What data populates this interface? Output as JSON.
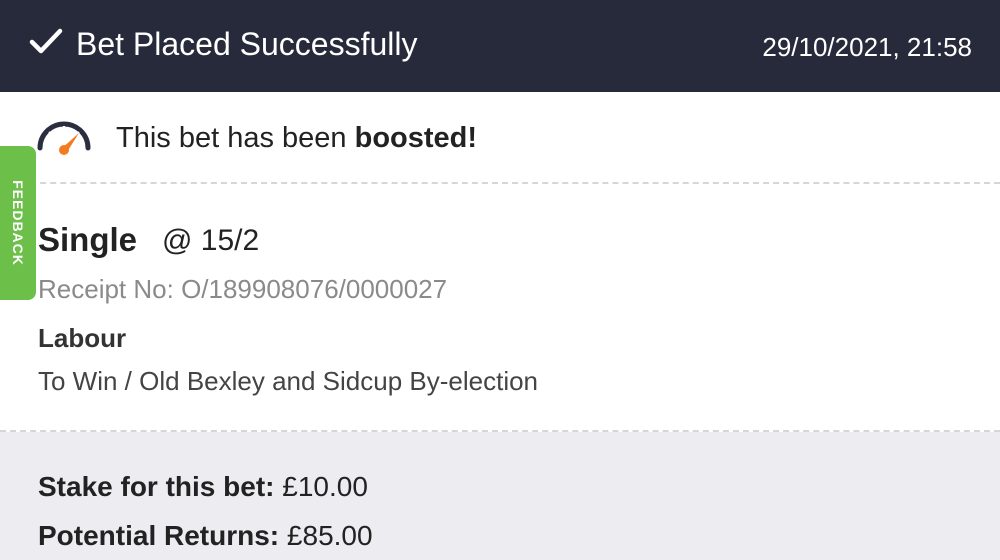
{
  "header": {
    "title": "Bet Placed Successfully",
    "timestamp": "29/10/2021, 21:58",
    "icon": "checkmark-icon",
    "background_color": "#262a3a"
  },
  "boost": {
    "icon": "speedometer-icon",
    "text_prefix": "This bet has been ",
    "text_emphasis": "boosted!",
    "icon_accent_color": "#f47b20"
  },
  "bet": {
    "type": "Single",
    "odds": "@ 15/2",
    "receipt": "Receipt No: O/189908076/0000027",
    "selection": "Labour",
    "market": "To Win / Old Bexley and Sidcup By-election"
  },
  "summary": {
    "stake_label": "Stake for this bet:",
    "stake_value": "£10.00",
    "returns_label": "Potential Returns:",
    "returns_value": "£85.00"
  },
  "feedback": {
    "label": "FEEDBACK",
    "color": "#6cc04a"
  }
}
